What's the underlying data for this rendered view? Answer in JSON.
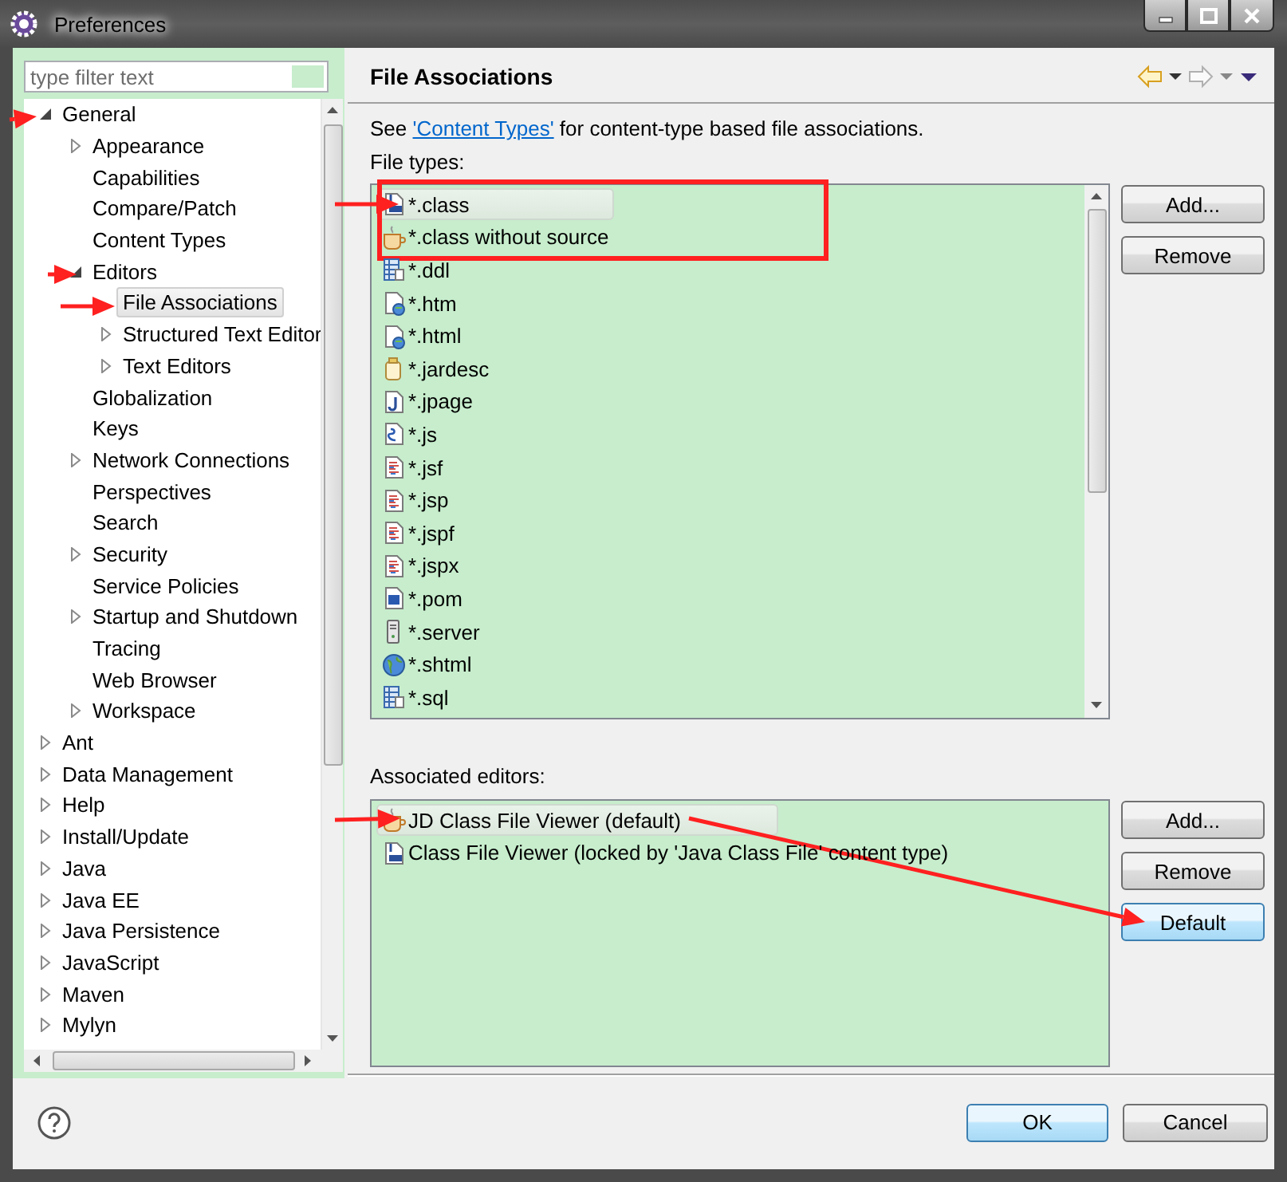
{
  "window": {
    "title": "Preferences"
  },
  "filter": {
    "placeholder": "type filter text"
  },
  "tree": [
    {
      "label": "General",
      "expanded": true,
      "selected": false,
      "children": [
        {
          "label": "Appearance",
          "expanded": false,
          "selected": false
        },
        {
          "label": "Capabilities",
          "selected": false
        },
        {
          "label": "Compare/Patch",
          "selected": false
        },
        {
          "label": "Content Types",
          "selected": false
        },
        {
          "label": "Editors",
          "expanded": true,
          "selected": false,
          "children": [
            {
              "label": "File Associations",
              "selected": true
            },
            {
              "label": "Structured Text Editor",
              "expanded": false,
              "selected": false
            },
            {
              "label": "Text Editors",
              "expanded": false,
              "selected": false
            }
          ]
        },
        {
          "label": "Globalization",
          "selected": false
        },
        {
          "label": "Keys",
          "selected": false
        },
        {
          "label": "Network Connections",
          "expanded": false,
          "selected": false
        },
        {
          "label": "Perspectives",
          "selected": false
        },
        {
          "label": "Search",
          "selected": false
        },
        {
          "label": "Security",
          "expanded": false,
          "selected": false
        },
        {
          "label": "Service Policies",
          "selected": false
        },
        {
          "label": "Startup and Shutdown",
          "expanded": false,
          "selected": false
        },
        {
          "label": "Tracing",
          "selected": false
        },
        {
          "label": "Web Browser",
          "selected": false
        },
        {
          "label": "Workspace",
          "expanded": false,
          "selected": false
        }
      ]
    },
    {
      "label": "Ant",
      "expanded": false,
      "selected": false
    },
    {
      "label": "Data Management",
      "expanded": false,
      "selected": false
    },
    {
      "label": "Help",
      "expanded": false,
      "selected": false
    },
    {
      "label": "Install/Update",
      "expanded": false,
      "selected": false
    },
    {
      "label": "Java",
      "expanded": false,
      "selected": false
    },
    {
      "label": "Java EE",
      "expanded": false,
      "selected": false
    },
    {
      "label": "Java Persistence",
      "expanded": false,
      "selected": false
    },
    {
      "label": "JavaScript",
      "expanded": false,
      "selected": false
    },
    {
      "label": "Maven",
      "expanded": false,
      "selected": false
    },
    {
      "label": "Mylyn",
      "expanded": false,
      "selected": false
    }
  ],
  "page": {
    "title": "File Associations",
    "note": {
      "before": "See ",
      "link": "'Content Types'",
      "after": " for content-type based file associations."
    },
    "file_types_label": "File types:",
    "file_types": [
      {
        "name": "*.class",
        "kind": "binary",
        "selected": true
      },
      {
        "name": "*.class without source",
        "kind": "cup",
        "selected": false
      },
      {
        "name": "*.ddl",
        "kind": "table",
        "selected": false
      },
      {
        "name": "*.htm",
        "kind": "webdoc",
        "selected": false
      },
      {
        "name": "*.html",
        "kind": "webdoc",
        "selected": false
      },
      {
        "name": "*.jardesc",
        "kind": "jar",
        "selected": false
      },
      {
        "name": "*.jpage",
        "kind": "jpage",
        "selected": false
      },
      {
        "name": "*.js",
        "kind": "script",
        "selected": false
      },
      {
        "name": "*.jsf",
        "kind": "text",
        "selected": false
      },
      {
        "name": "*.jsp",
        "kind": "text",
        "selected": false
      },
      {
        "name": "*.jspf",
        "kind": "text",
        "selected": false
      },
      {
        "name": "*.jspx",
        "kind": "text",
        "selected": false
      },
      {
        "name": "*.pom",
        "kind": "maven",
        "selected": false
      },
      {
        "name": "*.server",
        "kind": "server",
        "selected": false
      },
      {
        "name": "*.shtml",
        "kind": "globe",
        "selected": false
      },
      {
        "name": "*.sql",
        "kind": "table",
        "selected": false
      }
    ],
    "file_type_buttons": [
      "Add...",
      "Remove"
    ],
    "editors_label": "Associated editors:",
    "editors": [
      {
        "name": "JD Class File Viewer (default)",
        "kind": "cup",
        "selected": true
      },
      {
        "name": "Class File Viewer (locked by 'Java Class File' content type)",
        "kind": "binary",
        "selected": false
      }
    ],
    "editor_buttons": [
      {
        "label": "Add...",
        "focused": false
      },
      {
        "label": "Remove",
        "focused": false
      },
      {
        "label": "Default",
        "focused": true
      }
    ]
  },
  "footer": {
    "buttons": [
      {
        "label": "OK",
        "default": true
      },
      {
        "label": "Cancel",
        "default": false
      }
    ]
  }
}
